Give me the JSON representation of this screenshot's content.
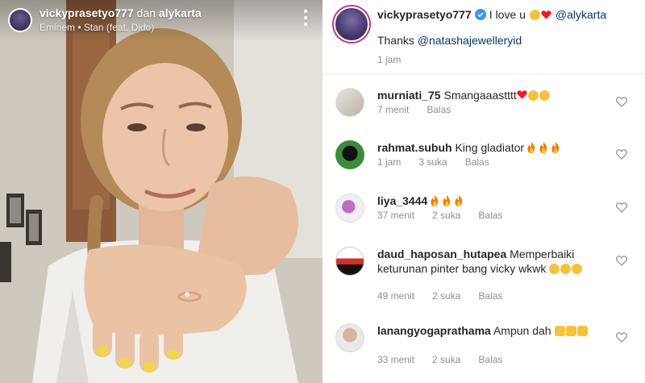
{
  "post": {
    "owner": "vickyprasetyo777",
    "conjunction": "dan",
    "collaborator": "alykarta",
    "song": "Eminem • Stan (feat. Dido)"
  },
  "caption": {
    "username": "vickyprasetyo777",
    "text": "I love u",
    "mention": "@alykarta",
    "thanks_text": "Thanks",
    "thanks_mention": "@natashajewelleryid",
    "time": "1 jam"
  },
  "comments": [
    {
      "username": "murniati_75",
      "text": "Smangaaastttt",
      "emojis": [
        "heart",
        "heart-eyes",
        "heart-eyes"
      ],
      "time": "7 menit",
      "likes": "",
      "reply": "Balas"
    },
    {
      "username": "rahmat.subuh",
      "text": "King gladiator",
      "emojis": [
        "fire",
        "fire",
        "fire"
      ],
      "time": "1 jam",
      "likes": "3 suka",
      "reply": "Balas"
    },
    {
      "username": "liya_3444",
      "text": "",
      "emojis": [
        "fire",
        "fire",
        "fire"
      ],
      "time": "37 menit",
      "likes": "2 suka",
      "reply": "Balas"
    },
    {
      "username": "daud_haposan_hutapea",
      "text": "Memperbaiki keturunan pinter bang vicky wkwk",
      "emojis": [
        "laugh",
        "laugh",
        "laugh"
      ],
      "time": "49 menit",
      "likes": "2 suka",
      "reply": "Balas"
    },
    {
      "username": "lanangyogaprathama",
      "text": "Ampun dah",
      "emojis": [
        "clap",
        "clap",
        "clap"
      ],
      "time": "33 menit",
      "likes": "2 suka",
      "reply": "Balas"
    }
  ],
  "icons": {
    "verified": "verified-badge-icon",
    "like": "heart-outline-icon",
    "more": "more-vertical-icon"
  },
  "colors": {
    "mention": "#00376b",
    "verified": "#3897f0",
    "secondary_text": "#8e8e8e",
    "heart": "#ed1c24"
  }
}
